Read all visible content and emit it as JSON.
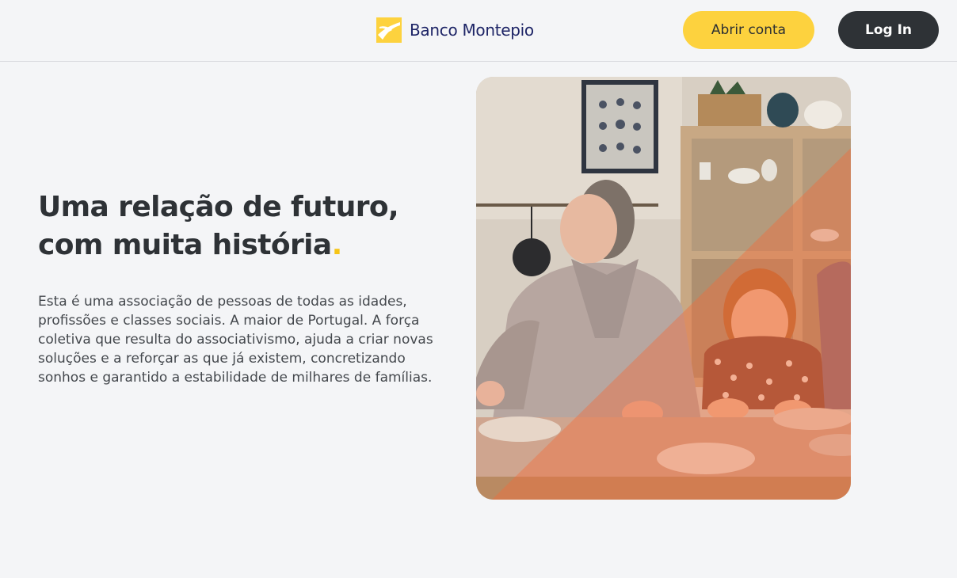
{
  "header": {
    "brand_name": "Banco Montepio",
    "open_account_label": "Abrir conta",
    "login_label": "Log In"
  },
  "hero": {
    "title": "Uma relação de futuro, com muita história",
    "title_dot": ".",
    "body": "Esta é uma associação de pessoas de todas as idades, profissões e classes sociais. A maior de Portugal. A força coletiva que resulta do associativismo, ajuda a criar novas soluções e a reforçar as que já existem, concretizando sonhos e garantido a estabilidade de milhares de famílias."
  },
  "colors": {
    "brand_yellow": "#fdd23e",
    "brand_navy": "#1d2466",
    "dark_button": "#2e3236",
    "accent_dot": "#f6c517",
    "overlay_orange": "#f26b3a"
  },
  "icons": {
    "logo": "montepio-bird-logo-icon"
  }
}
